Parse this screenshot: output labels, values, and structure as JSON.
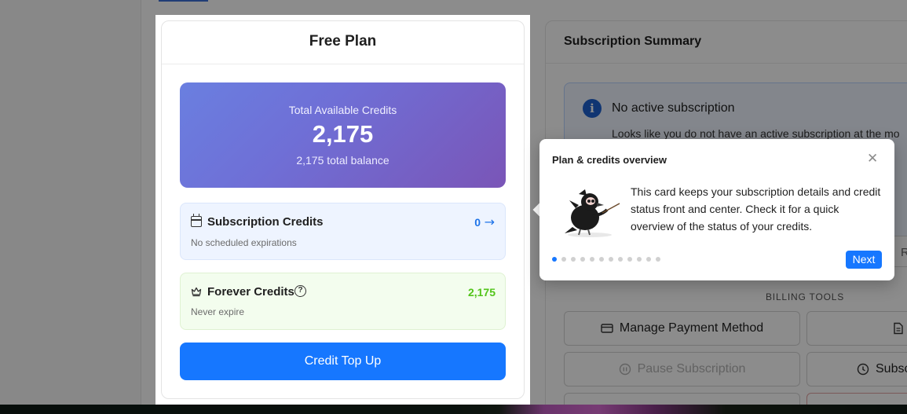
{
  "plan_card": {
    "title": "Free Plan",
    "hero": {
      "label": "Total Available Credits",
      "value": "2,175",
      "subtext": "2,175 total balance"
    },
    "subscription_credits": {
      "title": "Subscription Credits",
      "value": "0",
      "note": "No scheduled expirations",
      "icon": "calendar-icon",
      "arrow_icon": "arrow-right-icon"
    },
    "forever_credits": {
      "title": "Forever Credits",
      "value": "2,175",
      "note": "Never expire",
      "icon": "crown-icon",
      "help_icon": "question-circle-icon"
    },
    "topup_label": "Credit Top Up"
  },
  "summary": {
    "title": "Subscription Summary",
    "alert_title": "No active subscription",
    "alert_text": "Looks like you do not have an active subscription at the mo",
    "partial_button": "R",
    "billing_tools_label": "BILLING TOOLS",
    "tools": [
      {
        "label": "Manage Payment Method",
        "icon": "card-icon",
        "disabled": false
      },
      {
        "label": "",
        "icon": "file-icon",
        "disabled": false
      },
      {
        "label": "Pause Subscription",
        "icon": "pause-circle-icon",
        "disabled": true
      },
      {
        "label": "Subsc",
        "icon": "clock-icon",
        "disabled": false
      }
    ]
  },
  "tour": {
    "title": "Plan & credits overview",
    "body": "This card keeps your subscription details and credit status front and center. Check it for a quick overview of the status of your credits.",
    "next_label": "Next",
    "step": 1,
    "total_steps": 12,
    "illustration": "crow-mascot-illustration"
  },
  "colors": {
    "accent": "#1677ff",
    "forever_green": "#52c41a",
    "hero_start": "#6a7fe0",
    "hero_end": "#7a55b7"
  }
}
